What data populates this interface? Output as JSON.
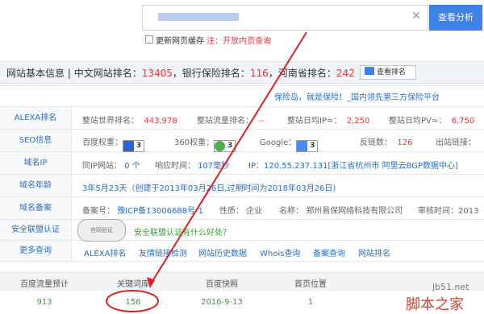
{
  "search": {
    "button_label": "查看分析",
    "checkbox_label": "更新网页缓存",
    "checkbox_note": "注：开放内页查询"
  },
  "header": {
    "title": "网站基本信息",
    "cn_rank_label": "中文网站排名：",
    "cn_rank": "13405",
    "industry_rank_label": "，银行保险排名：",
    "industry_rank": "116",
    "province_rank_label": "，河南省排名：",
    "province_rank": "242",
    "view_rank_button": "查看排名"
  },
  "description": "保险岛，就是保险！_国内领先第三方保险平台",
  "rows": {
    "alexa": {
      "label": "ALEXA排名",
      "world_rank_label": "整站世界排名：",
      "world_rank": "443,978",
      "traffic_rank_label": "整站流量排名：",
      "traffic_rank": "--",
      "daily_ip_label": "整站日均IP≈：",
      "daily_ip": "2,250",
      "daily_pv_label": "整站日均PV≈：",
      "daily_pv": "6,750"
    },
    "seo": {
      "label": "SEO信息",
      "baidu_label": "百度权重：",
      "baidu_value": "3",
      "r360_label": "360权重：",
      "r360_value": "3",
      "google_label": "Google：",
      "google_value": "3",
      "backlinks_label": "反链数：",
      "backlinks": "126",
      "outlinks_label": "出站链接："
    },
    "ip": {
      "label": "域名IP",
      "same_ip_label": "同IP网站：",
      "same_ip": "0 个",
      "response_label": "响应时间：",
      "response": "107毫秒",
      "ip_text": "IP：120.55.237.131[浙江省杭州市 阿里云BGP数据中心]"
    },
    "age": {
      "label": "域名年龄",
      "value": "3年5月23天（创建于2013年03月26日,过期时间为2018年03月26日)"
    },
    "icp": {
      "label": "域名备案",
      "number_label": "备案号：",
      "number": "豫ICP备13006688号-1",
      "nature_label": "性质：",
      "nature": "企业",
      "name_label": "名称：",
      "name": "郑州易保网络科技有限公司",
      "audit_label": "审核时间：",
      "audit": "2013"
    },
    "security": {
      "label": "安全联盟认证",
      "seal_text": "官网验证",
      "text": "安全联盟认证有什么好处？"
    },
    "more": {
      "label": "更多查询",
      "links": [
        "ALEXA排名",
        "友情链接检测",
        "网站历史数据",
        "Whois查询",
        "备案查询",
        "网站排名"
      ]
    }
  },
  "stats_table": {
    "headers": [
      "百度流量预计",
      "关键词库",
      "百度快照",
      "首页位置"
    ],
    "values": [
      "913",
      "156",
      "2016-9-13",
      "1"
    ]
  },
  "watermark": {
    "site": "jb51.net",
    "brand": "脚本之家"
  },
  "colors": {
    "accent": "#3e82e8",
    "highlight_red": "#e4393c",
    "link_blue": "#2a6ebf",
    "value_green": "#39a03c"
  }
}
